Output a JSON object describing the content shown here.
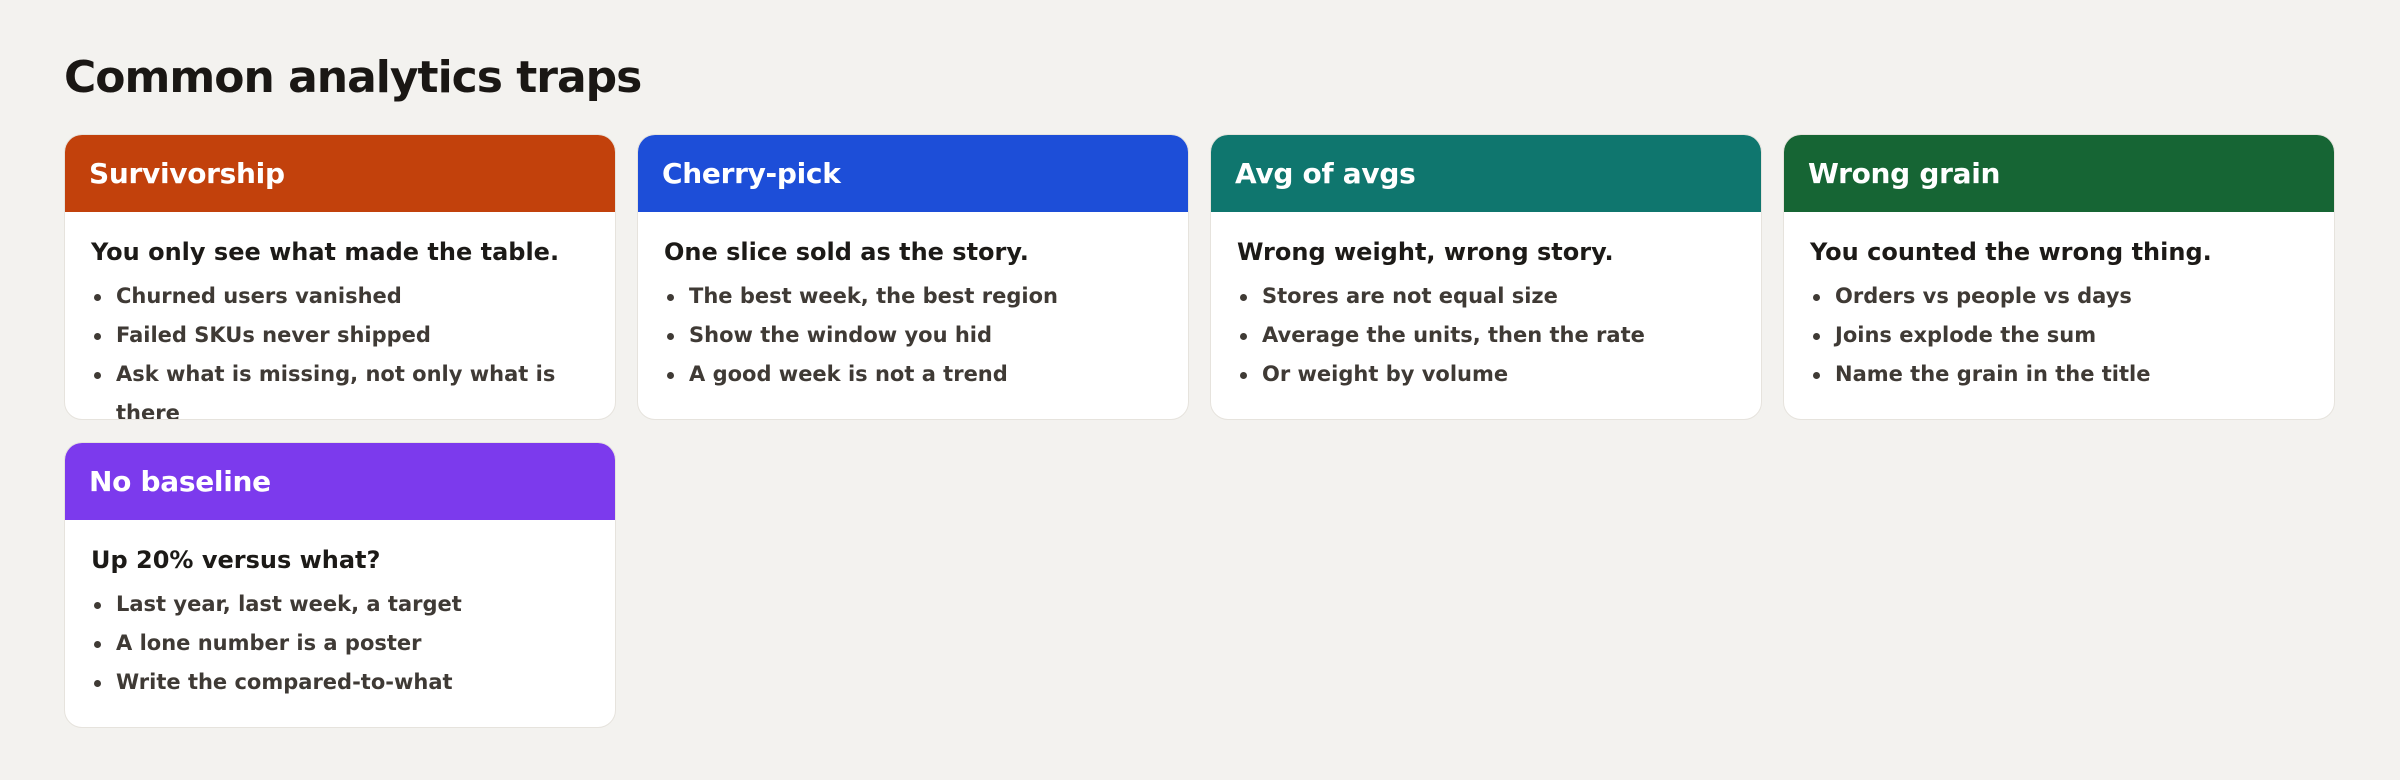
{
  "page": {
    "title": "Common analytics traps"
  },
  "cards": [
    {
      "title": "Survivorship",
      "color": "#c2410c",
      "lead": "You only see what made the table.",
      "points": [
        "Churned users vanished",
        "Failed SKUs never shipped",
        "Ask what is missing, not only what is there"
      ]
    },
    {
      "title": "Cherry-pick",
      "color": "#1d4ed8",
      "lead": "One slice sold as the story.",
      "points": [
        "The best week, the best region",
        "Show the window you hid",
        "A good week is not a trend"
      ]
    },
    {
      "title": "Avg of avgs",
      "color": "#0f766e",
      "lead": "Wrong weight, wrong story.",
      "points": [
        "Stores are not equal size",
        "Average the units, then the rate",
        "Or weight by volume"
      ]
    },
    {
      "title": "Wrong grain",
      "color": "#166534",
      "lead": "You counted the wrong thing.",
      "points": [
        "Orders vs people vs days",
        "Joins explode the sum",
        "Name the grain in the title"
      ]
    },
    {
      "title": "No baseline",
      "color": "#7c3aed",
      "lead": "Up 20% versus what?",
      "points": [
        "Last year, last week, a target",
        "A lone number is a poster",
        "Write the compared-to-what"
      ]
    }
  ]
}
